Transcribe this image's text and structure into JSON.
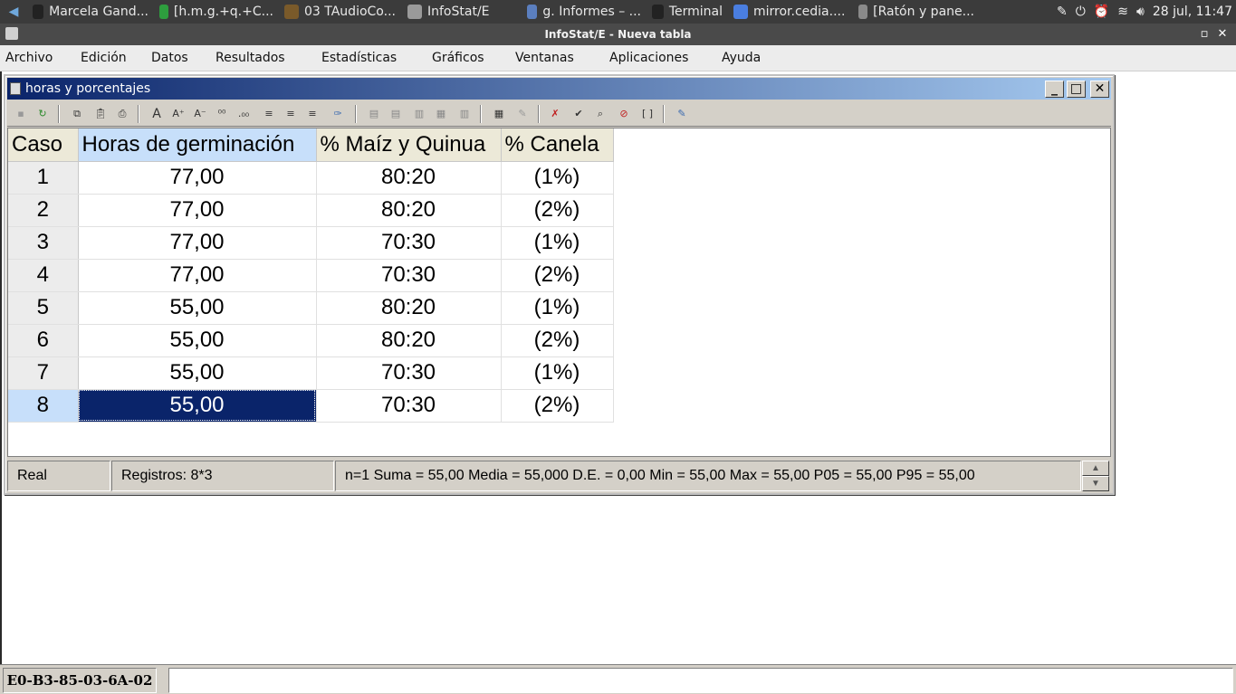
{
  "taskbar": {
    "items": [
      {
        "label": "Marcela Gand...",
        "icon": "circle-app-icon",
        "color": "#222222"
      },
      {
        "label": "[h.m.g.+q.+C...",
        "icon": "spreadsheet-icon",
        "color": "#2e9e3e"
      },
      {
        "label": "03 TAudioCo...",
        "icon": "windows-app-icon",
        "color": "#7a5a2a"
      },
      {
        "label": "InfoStat/E",
        "icon": "document-icon",
        "color": "#9a9a9a"
      },
      {
        "label": "g. Informes – ...",
        "icon": "text-doc-icon",
        "color": "#5b7fbf"
      },
      {
        "label": "Terminal",
        "icon": "terminal-icon",
        "color": "#222222"
      },
      {
        "label": "mirror.cedia....",
        "icon": "chrome-icon",
        "color": "#4a7ee0"
      },
      {
        "label": "[Ratón y pane...",
        "icon": "mouse-icon",
        "color": "#8a8a8a"
      }
    ],
    "clock": "28 jul, 11:47"
  },
  "app": {
    "title": "InfoStat/E - Nueva tabla"
  },
  "menu": [
    "Archivo",
    "Edición",
    "Datos",
    "Resultados",
    "Estadísticas",
    "Gráficos",
    "Ventanas",
    "Aplicaciones",
    "Ayuda"
  ],
  "child": {
    "title": "horas y porcentajes",
    "columns": [
      "Caso",
      "Horas de germinación",
      "% Maíz y Quinua",
      "% Canela"
    ],
    "rows": [
      [
        "1",
        "77,00",
        "80:20",
        "(1%)"
      ],
      [
        "2",
        "77,00",
        "80:20",
        "(2%)"
      ],
      [
        "3",
        "77,00",
        "70:30",
        "(1%)"
      ],
      [
        "4",
        "77,00",
        "70:30",
        "(2%)"
      ],
      [
        "5",
        "55,00",
        "80:20",
        "(1%)"
      ],
      [
        "6",
        "55,00",
        "80:20",
        "(2%)"
      ],
      [
        "7",
        "55,00",
        "70:30",
        "(1%)"
      ],
      [
        "8",
        "55,00",
        "70:30",
        "(2%)"
      ]
    ],
    "selected_row": 8,
    "status": {
      "type": "Real",
      "registros": "Registros: 8*3",
      "stats": "n=1   Suma = 55,00   Media = 55,000   D.E. = 0,00   Min = 55,00   Max = 55,00   P05 = 55,00   P95 = 55,00"
    }
  },
  "bottom": {
    "mac": "E0-B3-85-03-6A-02"
  },
  "colors": {
    "selection": "#0a246a",
    "header_selected": "#c7dffa",
    "title_gradient_start": "#0a246a",
    "title_gradient_end": "#a6caf0"
  }
}
